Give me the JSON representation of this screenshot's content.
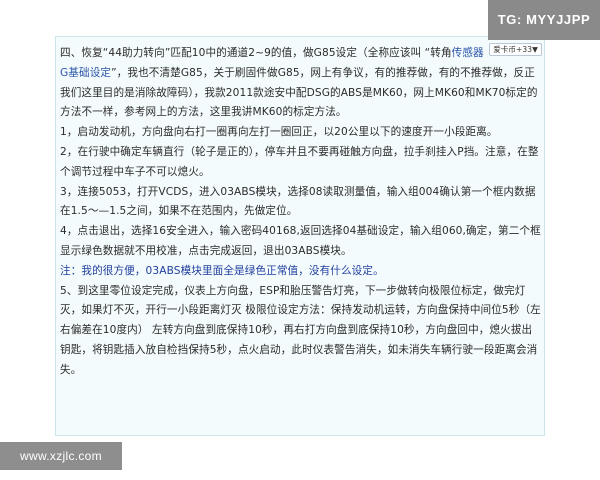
{
  "watermark_top": "TG: MYYJJPP",
  "watermark_bottom": "www.xzjlc.com",
  "user_badge": "爱卡币+33",
  "paragraphs": [
    {
      "pre": "四、恢复“44助力转向”匹配10中的通道2~9的值，做G85设定（全称应该叫 “转角",
      "hl": "传感器G基础设定",
      "post": "”，我也不清楚G85，关于刷固件做G85，网上有争议，有的推荐做，有的不推荐做，反正我们这里目的是消除故障码），我款2011款途安中配DSG的ABS是MK60，网上MK60和MK70标定的方法不一样，参考网上的方法，这里我讲MK60的标定方法。"
    },
    {
      "text": "1，启动发动机，方向盘向右打一圈再向左打一圈回正，以20公里以下的速度开一小段距离。"
    },
    {
      "text": "2，在行驶中确定车辆直行（轮子是正的），停车并且不要再碰触方向盘，拉手刹挂入P挡。注意，在整个调节过程中车子不可以熄火。"
    },
    {
      "text": "3，连接5053，打开VCDS，进入03ABS模块，选择08读取测量值，输入组004确认第一个框内数据在1.5～—1.5之间，如果不在范围内，先做定位。"
    },
    {
      "text": "4，点击退出，选择16安全进入，输入密码40168,返回选择04基础设定，输入组060,确定，第二个框显示绿色数据就不用校准，点击完成返回，退出03ABS模块。"
    },
    {
      "text": "注：我的很方便，03ABS模块里面全是绿色正常值，没有什么设定。",
      "note": true
    },
    {
      "text": "5、到这里零位设定完成，仪表上方向盘，ESP和胎压警告灯亮，下一步做转向极限位标定，做完灯灭，如果灯不灭，开行一小段距离灯灭 极限位设定方法：保持发动机运转，方向盘保持中间位5秒（左右偏差在10度内） 左转方向盘到底保持10秒，再右打方向盘到底保持10秒，方向盘回中，熄火拔出钥匙，将钥匙插入放自检挡保持5秒，点火启动，此时仪表警告消失，如未消失车辆行驶一段距离会消失。"
    }
  ]
}
